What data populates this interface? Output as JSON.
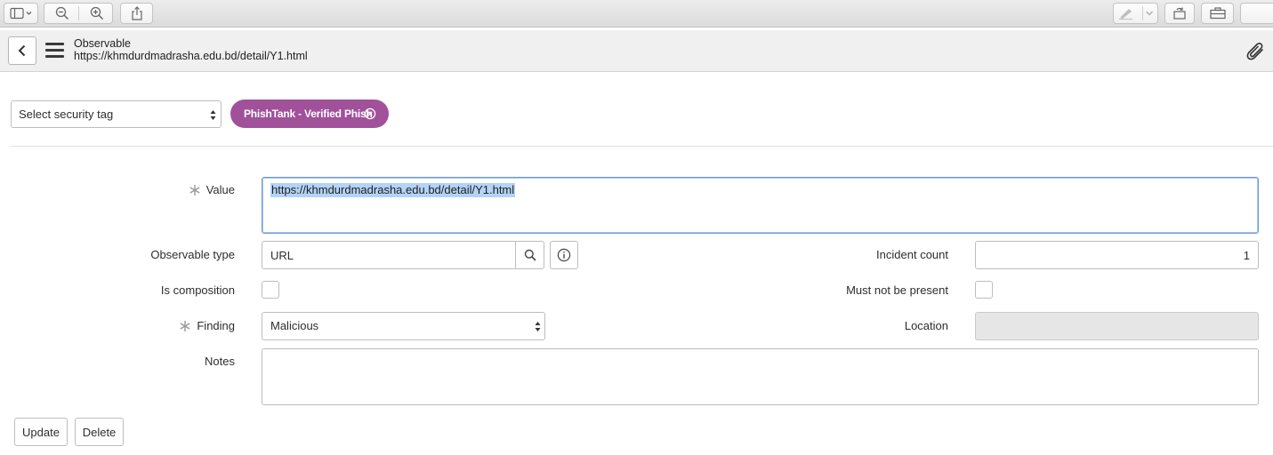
{
  "browser": {
    "toolbar_icons": [
      "sidebar-icon",
      "chevron-down-icon",
      "zoom-out-icon",
      "zoom-in-icon",
      "share-icon",
      "markup-pen-icon",
      "rotate-icon",
      "toolbox-icon"
    ]
  },
  "header": {
    "title": "Observable",
    "subtitle": "https://khmdurdmadrasha.edu.bd/detail/Y1.html"
  },
  "tags": {
    "select_placeholder": "Select security tag",
    "selected_tag": "PhishTank - Verified Phish",
    "tag_color": "#a0519a"
  },
  "form": {
    "value_label": "Value",
    "value": "https://khmdurdmadrasha.edu.bd/detail/Y1.html",
    "observable_type_label": "Observable type",
    "observable_type": "URL",
    "incident_count_label": "Incident count",
    "incident_count": "1",
    "is_composition_label": "Is composition",
    "must_not_be_present_label": "Must not be present",
    "finding_label": "Finding",
    "finding": "Malicious",
    "location_label": "Location",
    "location": "",
    "notes_label": "Notes",
    "notes": ""
  },
  "actions": {
    "update_label": "Update",
    "delete_label": "Delete"
  }
}
